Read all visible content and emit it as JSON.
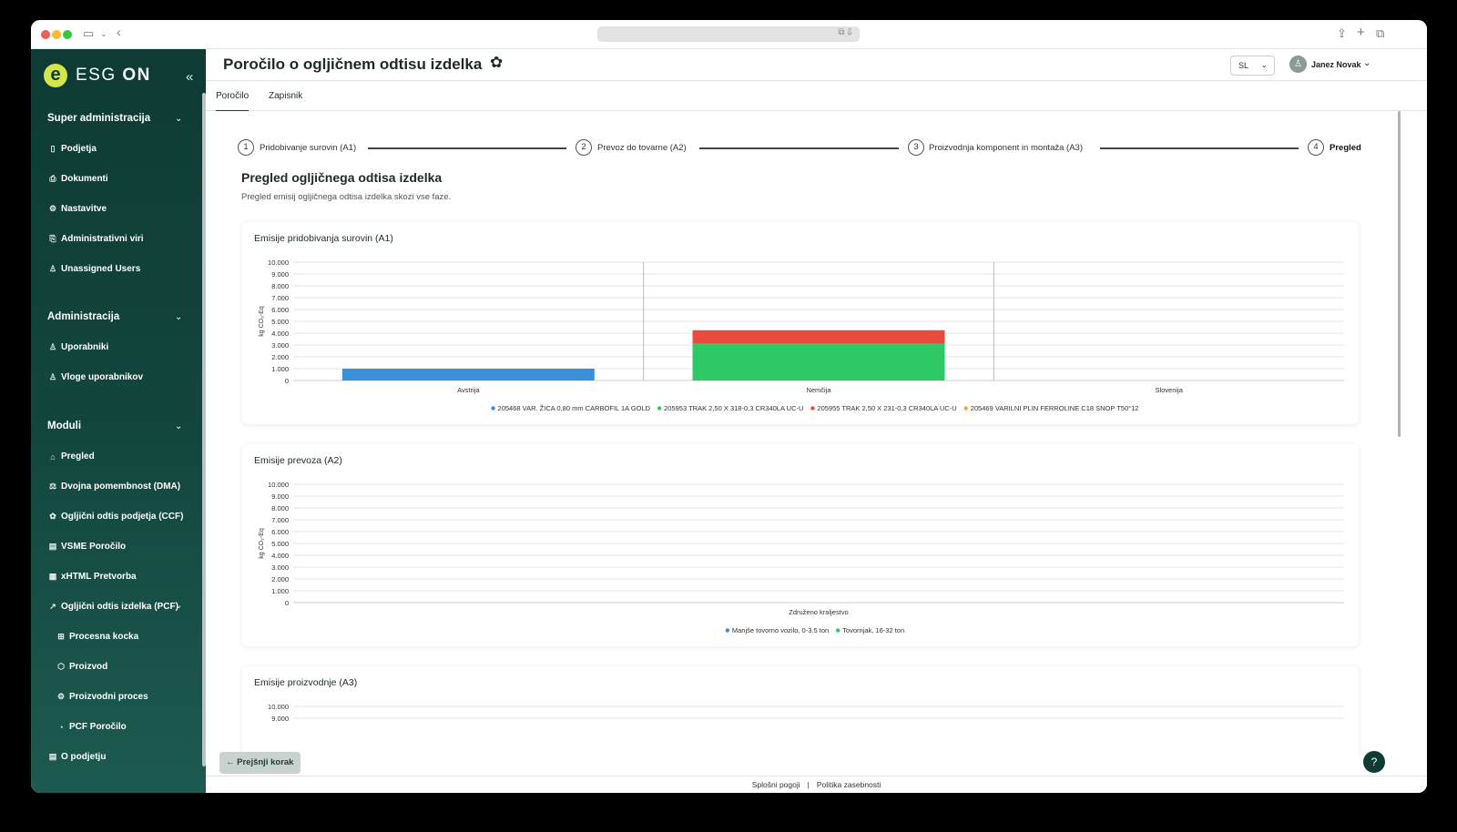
{
  "app": {
    "logo_mark": "e",
    "logo_text": "ESG",
    "logo_text_bold": "ON",
    "title": "Poročilo o ogljičnem odtisu izdelka"
  },
  "sidebar": {
    "sections": [
      {
        "label": "Super administracija",
        "items": [
          {
            "label": "Podjetja",
            "icon": "building-icon"
          },
          {
            "label": "Dokumenti",
            "icon": "document-icon"
          },
          {
            "label": "Nastavitve",
            "icon": "settings-icon"
          },
          {
            "label": "Administrativni viri",
            "icon": "resources-icon"
          },
          {
            "label": "Unassigned Users",
            "icon": "user-icon"
          }
        ]
      },
      {
        "label": "Administracija",
        "items": [
          {
            "label": "Uporabniki",
            "icon": "users-icon"
          },
          {
            "label": "Vloge uporabnikov",
            "icon": "roles-icon"
          }
        ]
      },
      {
        "label": "Moduli",
        "items": [
          {
            "label": "Pregled",
            "icon": "home-icon"
          },
          {
            "label": "Dvojna pomembnost (DMA)",
            "icon": "scale-icon"
          },
          {
            "label": "Ogljični odtis podjetja (CCF)",
            "icon": "footprint-icon"
          },
          {
            "label": "VSME Poročilo",
            "icon": "report-icon"
          },
          {
            "label": "xHTML Pretvorba",
            "icon": "convert-icon"
          },
          {
            "label": "Ogljični odtis izdelka (PCF)",
            "icon": "chart-icon"
          }
        ]
      },
      {
        "label": "",
        "items": [
          {
            "label": "Procesna kocka",
            "icon": "hierarchy-icon"
          },
          {
            "label": "Proizvod",
            "icon": "box-icon"
          },
          {
            "label": "Proizvodni proces",
            "icon": "gear-icon"
          },
          {
            "label": "PCF Poročilo",
            "icon": "pie-icon"
          }
        ]
      },
      {
        "label": "",
        "items": [
          {
            "label": "O podjetju",
            "icon": "company-icon"
          }
        ]
      }
    ]
  },
  "header": {
    "language": "SL",
    "user_name": "Janez Novak"
  },
  "tabs": [
    "Poročilo",
    "Zapisnik"
  ],
  "steps": [
    {
      "num": "1",
      "label": "Pridobivanje surovin (A1)"
    },
    {
      "num": "2",
      "label": "Prevoz do tovarne (A2)"
    },
    {
      "num": "3",
      "label": "Proizvodnja komponent in montaža (A3)"
    },
    {
      "num": "4",
      "label": "Pregled"
    }
  ],
  "main": {
    "heading": "Pregled ogljičnega odtisa izdelka",
    "description": "Pregled emisij ogljičnega odtisa izdelka skozi vse faze."
  },
  "chart_data": [
    {
      "type": "bar",
      "stacked": true,
      "title": "Emisije pridobivanja surovin (A1)",
      "ylabel": "kg CO₂-Eq",
      "ylim": [
        0,
        10000
      ],
      "yticks": [
        "10.000",
        "9.000",
        "8.000",
        "7.000",
        "6.000",
        "5.000",
        "4.000",
        "3.000",
        "2.000",
        "1.000",
        "0"
      ],
      "categories": [
        "Avstrija",
        "Nemčija",
        "Slovenija"
      ],
      "series": [
        {
          "name": "205468 VAR. ŽICA 0,80 mm CARBOFIL 1A GOLD",
          "color": "#3b8ed8",
          "values": [
            1000,
            0,
            0
          ]
        },
        {
          "name": "205953 TRAK 2,50 X 318-0,3 CR340LA UC-U",
          "color": "#2ec866",
          "values": [
            0,
            3100,
            0
          ]
        },
        {
          "name": "205955 TRAK 2,50 X 231-0,3 CR340LA UC-U",
          "color": "#e84a3c",
          "values": [
            0,
            1150,
            0
          ]
        },
        {
          "name": "205469 VARILNI PLIN FERROLINE C18 SNOP T50°12",
          "color": "#f2a33a",
          "values": [
            0,
            0,
            0
          ]
        }
      ],
      "legend": "bottom"
    },
    {
      "type": "bar",
      "stacked": true,
      "title": "Emisije prevoza (A2)",
      "ylabel": "kg CO₂-Eq",
      "ylim": [
        0,
        10000
      ],
      "yticks": [
        "10.000",
        "9.000",
        "8.000",
        "7.000",
        "6.000",
        "5.000",
        "4.000",
        "3.000",
        "2.000",
        "1.000",
        "0"
      ],
      "categories": [
        "Združeno kraljestvo"
      ],
      "series": [
        {
          "name": "Manjše tovorno vozilo, 0-3.5 ton",
          "color": "#3b8ed8",
          "values": [
            0
          ]
        },
        {
          "name": "Tovornjak, 16-32 ton",
          "color": "#2ec866",
          "values": [
            0
          ]
        }
      ],
      "legend": "bottom"
    },
    {
      "type": "bar",
      "title": "Emisije proizvodnje (A3)",
      "ylim": [
        0,
        10000
      ],
      "yticks": [
        "10.000",
        "9.000"
      ],
      "categories": [],
      "series": []
    }
  ],
  "footer": {
    "prev_label": "Prejšnji korak",
    "help": "?",
    "link_terms": "Splošni pogoji",
    "link_separator": "|",
    "link_privacy": "Politika zasebnosti"
  }
}
